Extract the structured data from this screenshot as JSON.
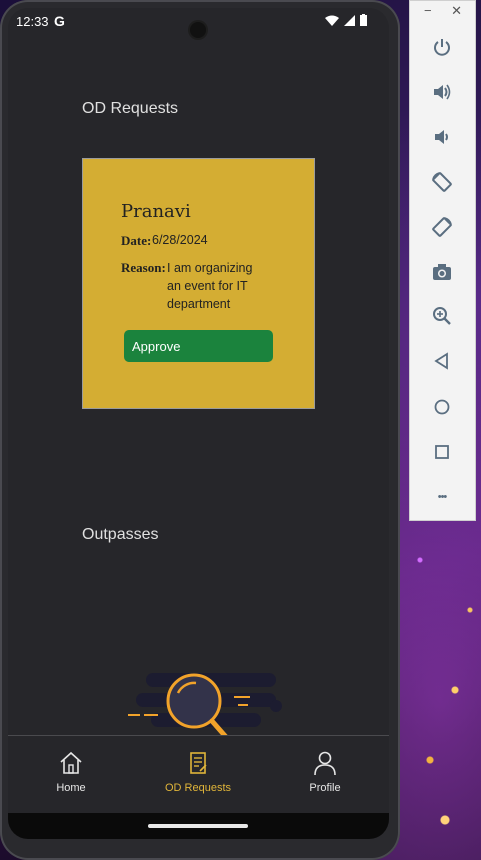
{
  "status_bar": {
    "time": "12:33",
    "google_glyph": "G"
  },
  "od_requests": {
    "section_title": "OD Requests",
    "card": {
      "name": "Pranavi",
      "date_label": "Date:",
      "date_value": "6/28/2024",
      "reason_label": "Reason:",
      "reason_value": "I am organizing an event for IT department",
      "approve_label": "Approve"
    }
  },
  "outpasses": {
    "section_title": "Outpasses"
  },
  "bottom_nav": {
    "items": [
      {
        "label": "Home",
        "icon": "home-icon"
      },
      {
        "label": "OD Requests",
        "icon": "document-icon",
        "active": true
      },
      {
        "label": "Profile",
        "icon": "person-icon"
      }
    ]
  },
  "emulator_toolbar": {
    "minimize": "−",
    "close": "✕",
    "buttons": [
      "power-icon",
      "volume-up-icon",
      "volume-down-icon",
      "rotate-left-icon",
      "rotate-right-icon",
      "camera-icon",
      "zoom-icon",
      "back-icon",
      "home-circle-icon",
      "overview-icon",
      "more-icon"
    ],
    "more_glyph": "•••"
  },
  "colors": {
    "card_bg": "#d4ad33",
    "approve_bg": "#1b833d",
    "accent": "#e0b53a",
    "screen_bg": "#26262a"
  }
}
